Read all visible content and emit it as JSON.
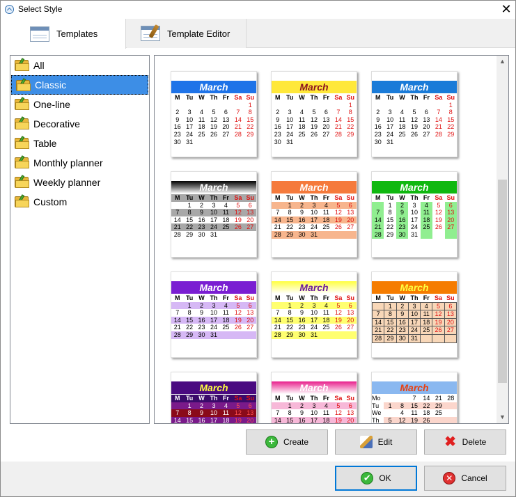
{
  "window": {
    "title": "Select Style"
  },
  "tabs": [
    {
      "label": "Templates"
    },
    {
      "label": "Template Editor"
    }
  ],
  "categories": [
    {
      "label": "All"
    },
    {
      "label": "Classic"
    },
    {
      "label": "One-line"
    },
    {
      "label": "Decorative"
    },
    {
      "label": "Table"
    },
    {
      "label": "Monthly planner"
    },
    {
      "label": "Weekly planner"
    },
    {
      "label": "Custom"
    }
  ],
  "selected_category": "Classic",
  "calendar": {
    "month": "March",
    "weekdays": [
      "M",
      "Tu",
      "W",
      "Th",
      "Fr",
      "Sa",
      "Su"
    ],
    "weekdays_vertical": [
      "Mo",
      "Tu",
      "We",
      "Th"
    ],
    "weeks": [
      [
        "",
        "",
        "",
        "",
        "",
        "",
        "1"
      ],
      [
        "2",
        "3",
        "4",
        "5",
        "6",
        "7",
        "8"
      ],
      [
        "9",
        "10",
        "11",
        "12",
        "13",
        "14",
        "15"
      ],
      [
        "16",
        "17",
        "18",
        "19",
        "20",
        "21",
        "22"
      ],
      [
        "23",
        "24",
        "25",
        "26",
        "27",
        "28",
        "29"
      ],
      [
        "30",
        "31",
        "",
        "",
        "",
        "",
        ""
      ]
    ],
    "weeks_alt": [
      [
        "",
        "1",
        "2",
        "3",
        "4",
        "5",
        "6"
      ],
      [
        "7",
        "8",
        "9",
        "10",
        "11",
        "12",
        "13"
      ],
      [
        "14",
        "15",
        "16",
        "17",
        "18",
        "19",
        "20"
      ],
      [
        "21",
        "22",
        "23",
        "24",
        "25",
        "26",
        "27"
      ],
      [
        "28",
        "29",
        "30",
        "31",
        "",
        "",
        ""
      ]
    ],
    "vertical_rows": [
      [
        "",
        "",
        "",
        "7",
        "14",
        "21",
        "28"
      ],
      [
        "",
        "1",
        "8",
        "15",
        "22",
        "29",
        ""
      ],
      [
        "",
        "",
        "4",
        "11",
        "18",
        "25",
        ""
      ],
      [
        "",
        "5",
        "12",
        "19",
        "26",
        "",
        ""
      ]
    ]
  },
  "templates": [
    {
      "id": 1,
      "header_bg": "#1e73e8",
      "header_color": "#ffffff"
    },
    {
      "id": 2,
      "header_bg": "#ffe83a",
      "header_color": "#8b1020"
    },
    {
      "id": 3,
      "header_bg": "#1a7bd8",
      "header_color": "#ffffff"
    },
    {
      "id": 4,
      "header_bg": "#222222",
      "header_color": "#ffffff"
    },
    {
      "id": 5,
      "header_bg": "#f57a3c",
      "header_color": "#ffffff"
    },
    {
      "id": 6,
      "header_bg": "#10b810",
      "header_color": "#ffffff"
    },
    {
      "id": 7,
      "header_bg": "#7a1ed2",
      "header_color": "#ffffff"
    },
    {
      "id": 8,
      "header_bg": "#ffff40",
      "header_color": "#6a1a9a"
    },
    {
      "id": 9,
      "header_bg": "#f57c00",
      "header_color": "#ffff40"
    },
    {
      "id": 10,
      "header_bg": "#4a0a80",
      "header_color": "#ffff40"
    },
    {
      "id": 11,
      "header_bg": "#e8208c",
      "header_color": "#ffffff"
    },
    {
      "id": 12,
      "header_bg": "#8ab8f0",
      "header_color": "#e84010"
    }
  ],
  "buttons": {
    "create": "Create",
    "edit": "Edit",
    "delete": "Delete",
    "ok": "OK",
    "cancel": "Cancel"
  },
  "colors": {
    "selection": "#3d8ee6",
    "weekend": "#e01010",
    "ok_border": "#0078d7"
  }
}
